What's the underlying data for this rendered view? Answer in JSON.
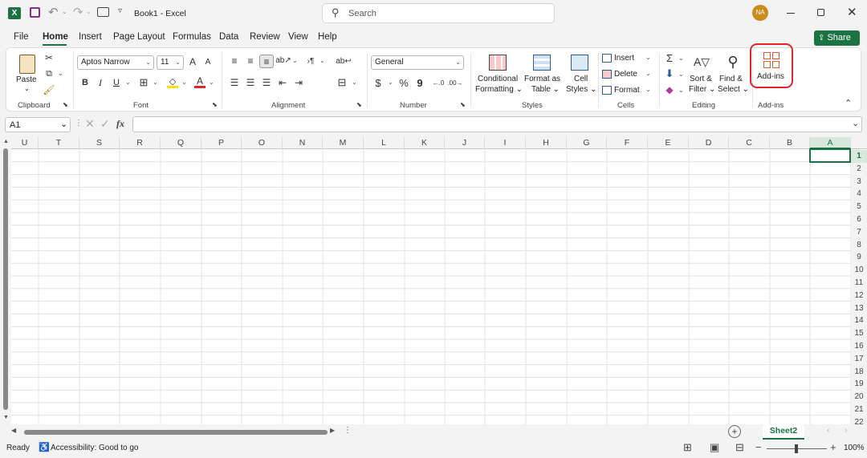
{
  "titlebar": {
    "doc_title": "Book1 - Excel",
    "search_placeholder": "Search",
    "avatar_initials": "NA",
    "share_label": "Share",
    "excel_logo": "X"
  },
  "tabs": [
    "File",
    "Home",
    "Insert",
    "Page Layout",
    "Formulas",
    "Data",
    "Review",
    "View",
    "Help"
  ],
  "ribbon": {
    "clipboard": {
      "paste": "Paste",
      "group": "Clipboard"
    },
    "font": {
      "name": "Aptos Narrow",
      "size": "11",
      "bold": "B",
      "italic": "I",
      "underline": "U",
      "grow": "A",
      "shrink": "A",
      "color": "A",
      "group": "Font"
    },
    "alignment": {
      "group": "Alignment"
    },
    "number": {
      "format": "General",
      "currency": "$",
      "percent": "%",
      "comma": "9",
      "group": "Number"
    },
    "styles": {
      "conditional1": "Conditional",
      "conditional2": "Formatting",
      "format_table1": "Format as",
      "format_table2": "Table",
      "cell_styles1": "Cell",
      "cell_styles2": "Styles",
      "group": "Styles"
    },
    "cells": {
      "insert": "Insert",
      "delete": "Delete",
      "format": "Format",
      "group": "Cells"
    },
    "editing": {
      "sum": "Σ",
      "sort1": "Sort &",
      "sort2": "Filter",
      "find1": "Find &",
      "find2": "Select",
      "group": "Editing"
    },
    "addins": {
      "label": "Add-ins",
      "group": "Add-ins"
    }
  },
  "formula_bar": {
    "name_box": "A1",
    "fx": "fx",
    "formula": ""
  },
  "sheet": {
    "columns": [
      "U",
      "T",
      "S",
      "R",
      "Q",
      "P",
      "O",
      "N",
      "M",
      "L",
      "K",
      "J",
      "I",
      "H",
      "G",
      "F",
      "E",
      "D",
      "C",
      "B",
      "A"
    ],
    "rows": [
      "1",
      "2",
      "3",
      "4",
      "5",
      "6",
      "7",
      "8",
      "9",
      "10",
      "11",
      "12",
      "13",
      "14",
      "15",
      "16",
      "17",
      "18",
      "19",
      "20",
      "21",
      "22"
    ],
    "active_cell": "A1",
    "tab": "Sheet2"
  },
  "status": {
    "ready": "Ready",
    "accessibility": "Accessibility: Good to go",
    "zoom": "100%"
  },
  "colors": {
    "excel_green": "#1f7145",
    "share_green": "#1b7343",
    "highlight_red": "#e0262a",
    "avatar": "#c98b1b"
  }
}
